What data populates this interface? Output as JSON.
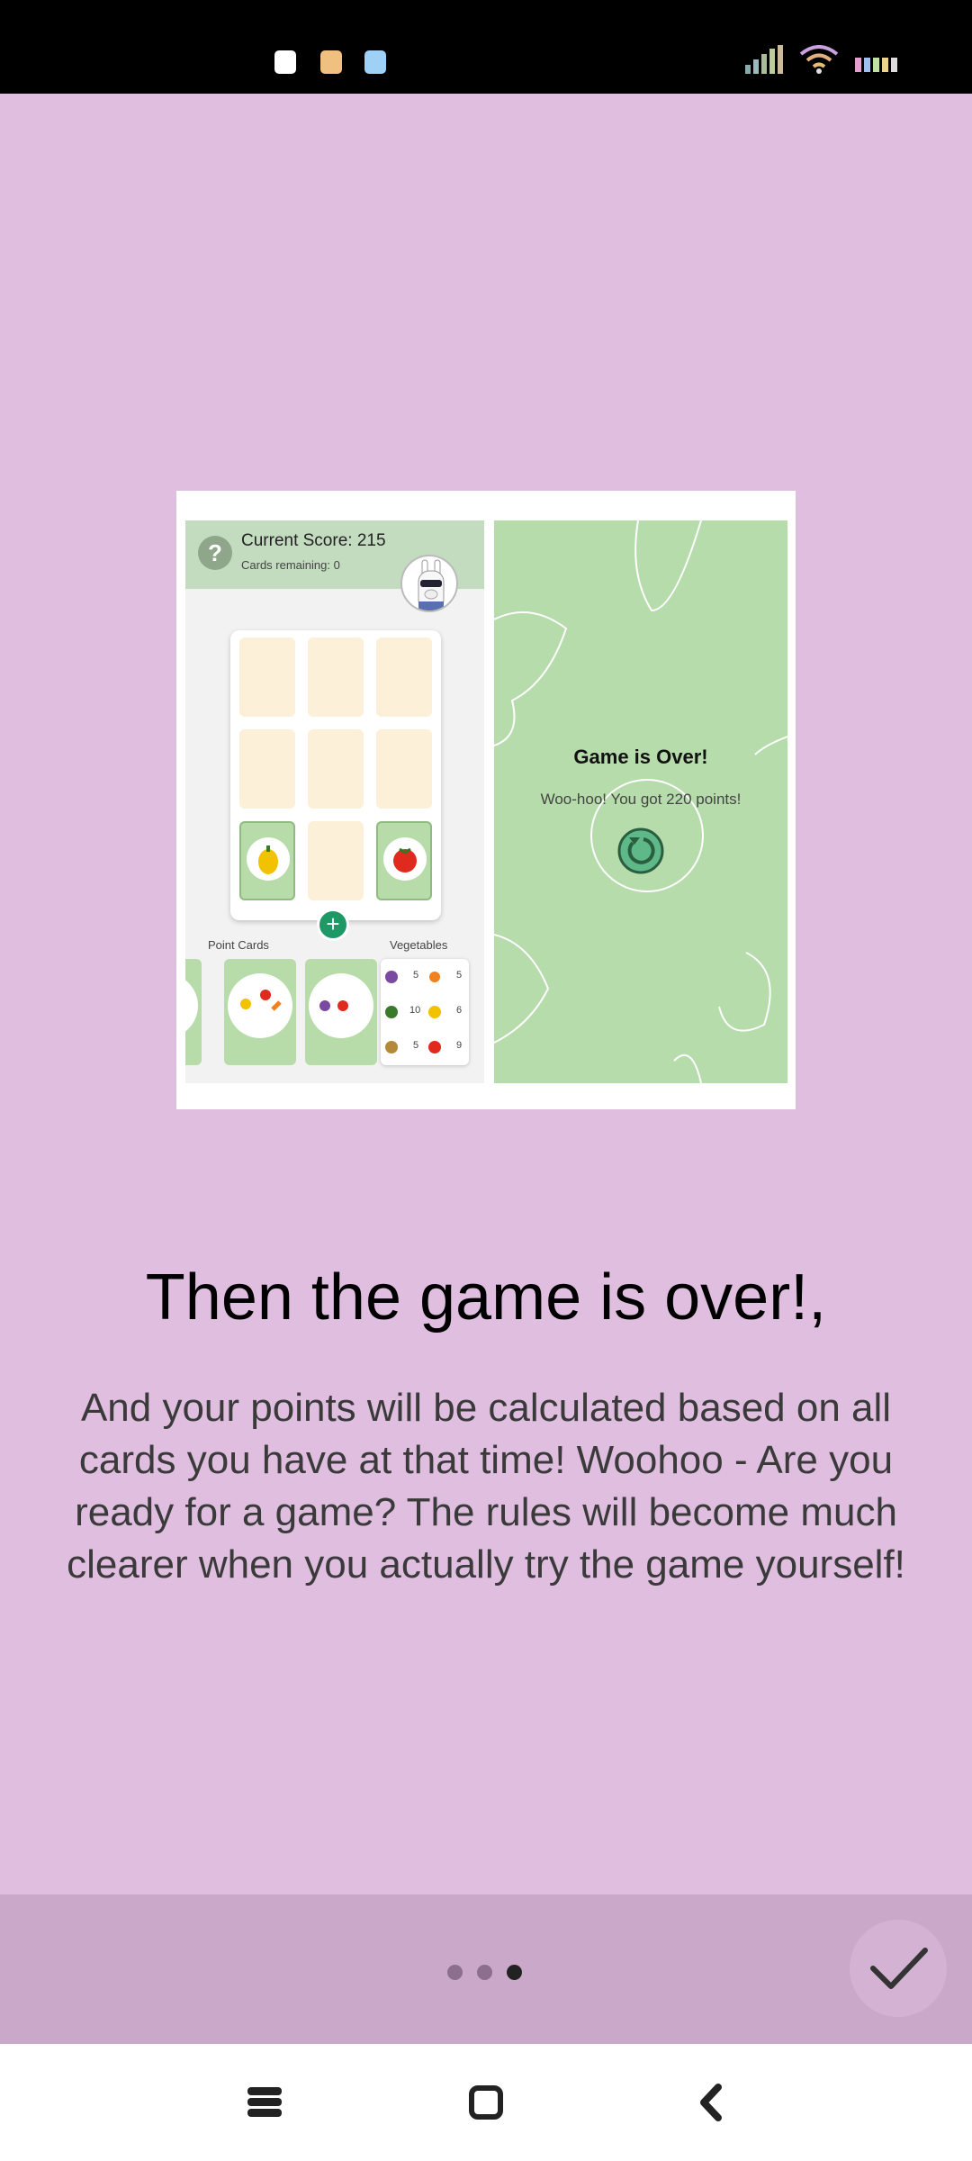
{
  "screen": {
    "title": "Then the game is over!,",
    "description": "And your points will be calculated based on all cards you have at that time! Woohoo - Are you ready for a game? The rules will become much clearer when you actually try the game yourself!"
  },
  "illustration": {
    "score_label": "Current Score: 215",
    "cards_remaining": "Cards remaining: 0",
    "point_cards_label": "Point Cards",
    "vegetables_label": "Vegetables",
    "game_over_title": "Game is Over!",
    "game_over_message": "Woo-hoo! You got 220 points!",
    "veg_table_values": [
      "5",
      "5",
      "10",
      "6",
      "5",
      "9"
    ]
  },
  "pagination": {
    "total": 3,
    "active": 3
  },
  "colors": {
    "background": "#e0bee0",
    "bottom_bar": "#c9a8c9",
    "accent_green": "#1e9966"
  },
  "icons": {
    "help": "help-icon",
    "add": "add-icon",
    "restart": "restart-icon",
    "confirm": "check-icon"
  }
}
